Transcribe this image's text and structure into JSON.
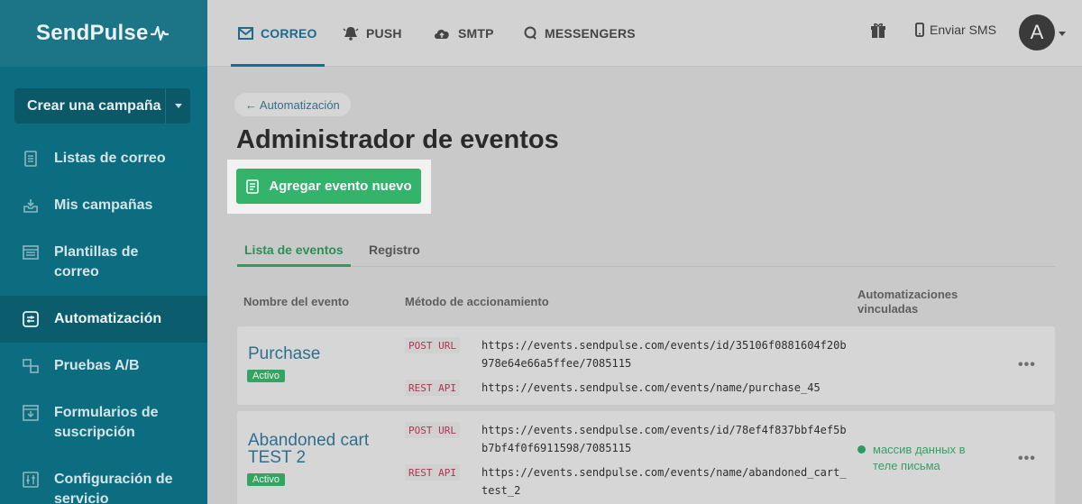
{
  "app": {
    "logo_text": "SendPulse",
    "accent_color": "#0d6d80",
    "success_color": "#34b36a"
  },
  "sidebar": {
    "create_label": "Crear una campaña",
    "items": [
      {
        "label": "Listas de correo",
        "icon": "list-icon"
      },
      {
        "label": "Mis campañas",
        "icon": "campaigns-icon"
      },
      {
        "label": "Plantillas de correo",
        "icon": "templates-icon"
      },
      {
        "label": "Automatización",
        "icon": "automation-icon",
        "active": true
      },
      {
        "label": "Pruebas A/B",
        "icon": "ab-test-icon"
      },
      {
        "label": "Formularios de suscripción",
        "icon": "forms-icon"
      },
      {
        "label": "Configuración de servicio",
        "icon": "settings-icon"
      }
    ]
  },
  "topbar": {
    "tabs": [
      {
        "label": "CORREO",
        "icon": "mail-icon",
        "active": true
      },
      {
        "label": "PUSH",
        "icon": "bell-icon"
      },
      {
        "label": "SMTP",
        "icon": "cloud-icon"
      },
      {
        "label": "MESSENGERS",
        "icon": "chat-icon"
      }
    ],
    "sms_label": "Enviar SMS",
    "avatar_letter": "A"
  },
  "main": {
    "breadcrumb": "← Automatización",
    "title": "Administrador de eventos",
    "add_button": "Agregar evento nuevo",
    "subtabs": [
      {
        "label": "Lista de eventos",
        "active": true
      },
      {
        "label": "Registro"
      }
    ],
    "columns": {
      "name": "Nombre del evento",
      "method": "Método de accionamiento",
      "linked": "Automatizaciones vinculadas"
    },
    "events": [
      {
        "name": "Purchase",
        "status": "Activo",
        "methods": [
          {
            "type": "POST URL",
            "url": "https://events.sendpulse.com/events/id/35106f0881604f20b978e64e66a5ffee/7085115"
          },
          {
            "type": "REST API",
            "url": "https://events.sendpulse.com/events/name/purchase_45"
          }
        ],
        "linked": "",
        "more": "•••"
      },
      {
        "name": "Abandoned cart TEST 2",
        "status": "Activo",
        "methods": [
          {
            "type": "POST URL",
            "url": "https://events.sendpulse.com/events/id/78ef4f837bbf4ef5bb7bf4f0f6911598/7085115"
          },
          {
            "type": "REST API",
            "url": "https://events.sendpulse.com/events/name/abandoned_cart_test_2"
          }
        ],
        "linked": "массив данных в теле письма",
        "more": "•••"
      }
    ]
  }
}
